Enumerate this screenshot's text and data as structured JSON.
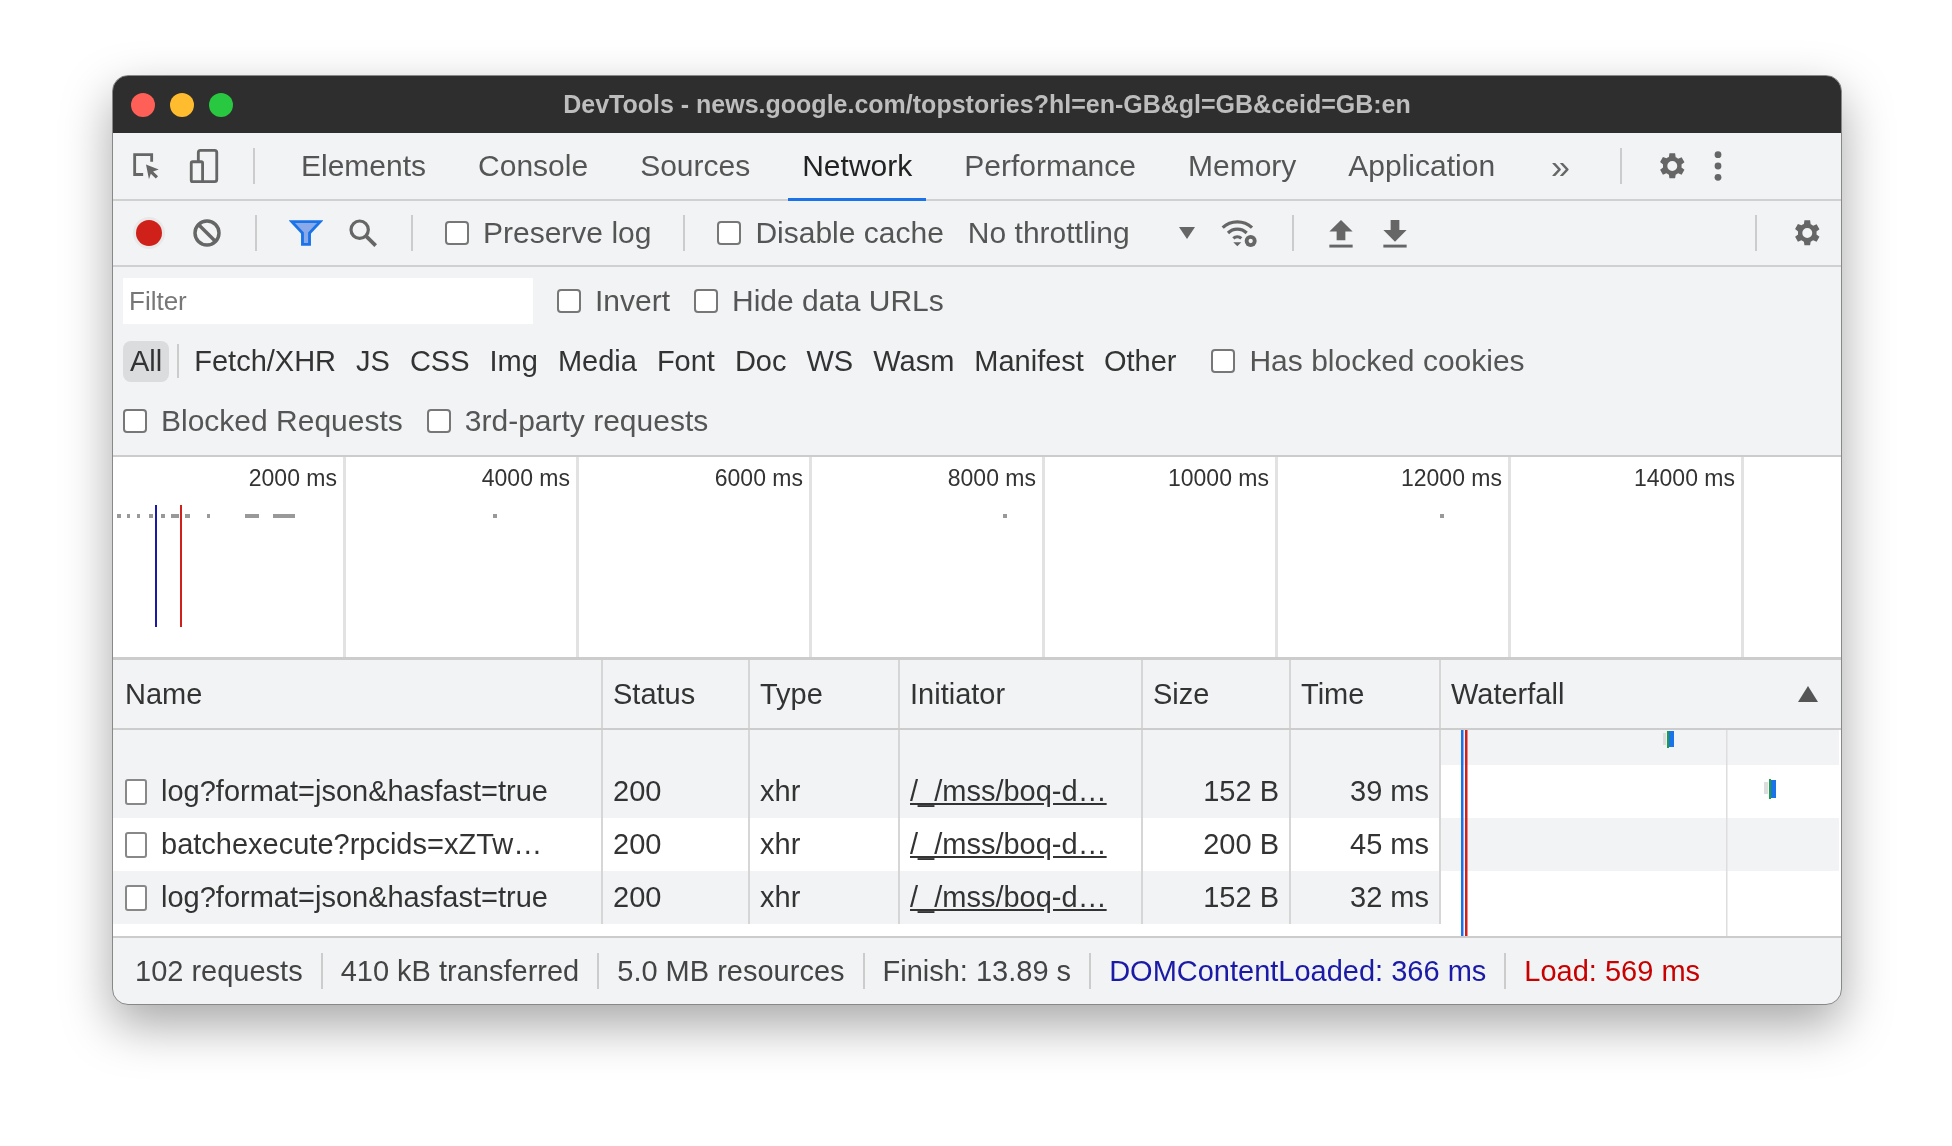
{
  "window": {
    "title": "DevTools - news.google.com/topstories?hl=en-GB&gl=GB&ceid=GB:en"
  },
  "tabs": [
    {
      "label": "Elements",
      "selected": false
    },
    {
      "label": "Console",
      "selected": false
    },
    {
      "label": "Sources",
      "selected": false
    },
    {
      "label": "Network",
      "selected": true
    },
    {
      "label": "Performance",
      "selected": false
    },
    {
      "label": "Memory",
      "selected": false
    },
    {
      "label": "Application",
      "selected": false
    }
  ],
  "tabs_overflow": "»",
  "toolbar": {
    "recording": true,
    "preserve_log": {
      "label": "Preserve log",
      "checked": false
    },
    "disable_cache": {
      "label": "Disable cache",
      "checked": false
    },
    "throttling": "No throttling"
  },
  "filter": {
    "placeholder": "Filter",
    "invert": {
      "label": "Invert",
      "checked": false
    },
    "hide_data_urls": {
      "label": "Hide data URLs",
      "checked": false
    }
  },
  "types": [
    {
      "label": "All",
      "selected": true
    },
    {
      "label": "Fetch/XHR",
      "selected": false
    },
    {
      "label": "JS",
      "selected": false
    },
    {
      "label": "CSS",
      "selected": false
    },
    {
      "label": "Img",
      "selected": false
    },
    {
      "label": "Media",
      "selected": false
    },
    {
      "label": "Font",
      "selected": false
    },
    {
      "label": "Doc",
      "selected": false
    },
    {
      "label": "WS",
      "selected": false
    },
    {
      "label": "Wasm",
      "selected": false
    },
    {
      "label": "Manifest",
      "selected": false
    },
    {
      "label": "Other",
      "selected": false
    }
  ],
  "has_blocked_cookies": {
    "label": "Has blocked cookies",
    "checked": false
  },
  "blocked_requests": {
    "label": "Blocked Requests",
    "checked": false
  },
  "third_party": {
    "label": "3rd-party requests",
    "checked": false
  },
  "overview": {
    "ticks": [
      "2000 ms",
      "4000 ms",
      "6000 ms",
      "8000 ms",
      "10000 ms",
      "12000 ms",
      "14000 ms"
    ]
  },
  "table": {
    "columns": [
      "Name",
      "Status",
      "Type",
      "Initiator",
      "Size",
      "Time",
      "Waterfall"
    ],
    "rows": [
      {
        "name": "log?format=json&hasfast=true",
        "status": "200",
        "type": "xhr",
        "initiator": "/_/mss/boq-d…",
        "size": "152 B",
        "time": "39 ms"
      },
      {
        "name": "batchexecute?rpcids=xZTw…",
        "status": "200",
        "type": "xhr",
        "initiator": "/_/mss/boq-d…",
        "size": "200 B",
        "time": "45 ms"
      },
      {
        "name": "log?format=json&hasfast=true",
        "status": "200",
        "type": "xhr",
        "initiator": "/_/mss/boq-d…",
        "size": "152 B",
        "time": "32 ms"
      }
    ]
  },
  "status_bar": [
    {
      "text": "102 requests",
      "kind": "plain"
    },
    {
      "text": "410 kB transferred",
      "kind": "plain"
    },
    {
      "text": "5.0 MB resources",
      "kind": "plain"
    },
    {
      "text": "Finish: 13.89 s",
      "kind": "plain"
    },
    {
      "text": "DOMContentLoaded: 366 ms",
      "kind": "dom"
    },
    {
      "text": "Load: 569 ms",
      "kind": "load"
    }
  ]
}
